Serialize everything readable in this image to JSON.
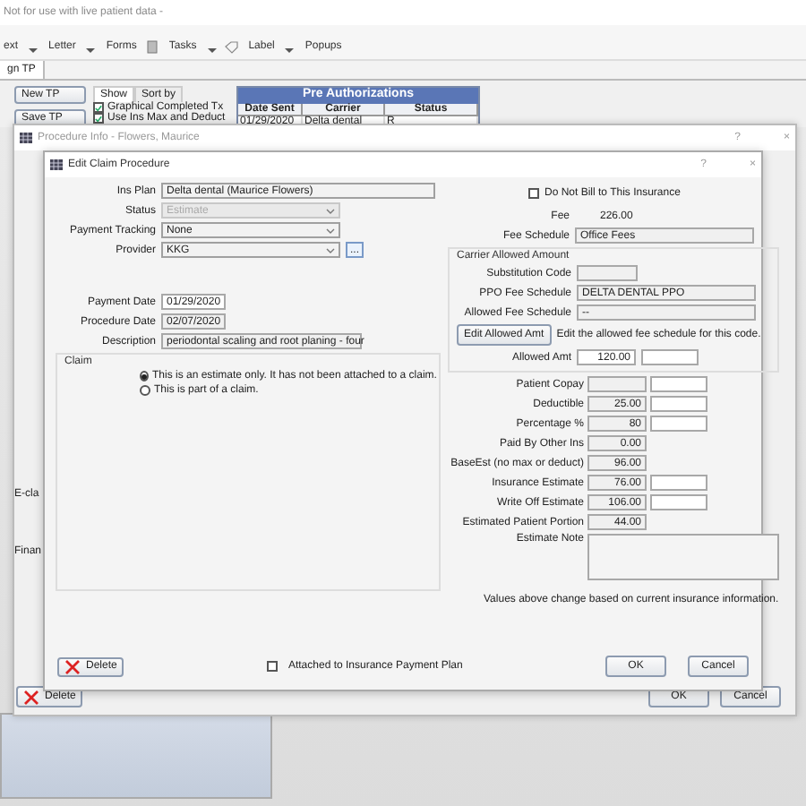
{
  "app": {
    "title": "Not for use with live patient data -",
    "toolbar": [
      {
        "label": "ext",
        "dropdown": true
      },
      {
        "label": "Letter",
        "dropdown": true
      },
      {
        "label": "Forms",
        "dropdown": false
      },
      {
        "label": "Tasks",
        "dropdown": true
      },
      {
        "label": "Label",
        "dropdown": true
      },
      {
        "label": "Popups",
        "dropdown": false
      }
    ],
    "tabs": [
      {
        "label": "gn TP",
        "selected": true
      }
    ],
    "tp_buttons": [
      "New TP",
      "Save TP"
    ],
    "show_tabs": [
      {
        "label": "Show",
        "selected": true
      },
      {
        "label": "Sort by",
        "selected": false
      }
    ],
    "options": [
      {
        "label": "Graphical Completed Tx",
        "checked": true
      },
      {
        "label": "Use Ins Max and Deduct",
        "checked": true
      }
    ],
    "pre_authorizations": {
      "title": "Pre Authorizations",
      "columns": [
        "Date Sent",
        "Carrier",
        "Status"
      ],
      "rows": [
        [
          "01/29/2020",
          "Delta dental",
          "R"
        ]
      ]
    }
  },
  "procedure_info": {
    "title": "Procedure Info - Flowers, Maurice",
    "help": "?",
    "close": "×",
    "fragments": [
      "E-cla",
      "Finan"
    ],
    "buttons": {
      "delete": "Delete",
      "ok": "OK",
      "cancel": "Cancel"
    }
  },
  "edit_claim": {
    "title": "Edit Claim Procedure",
    "help": "?",
    "close": "×",
    "left_fields": [
      {
        "label": "Ins Plan",
        "value": "Delta dental  (Maurice Flowers)",
        "kind": "text",
        "disabled": false
      },
      {
        "label": "Status",
        "value": "Estimate",
        "kind": "combo",
        "disabled": true
      },
      {
        "label": "Payment Tracking",
        "value": "None",
        "kind": "combo",
        "disabled": false
      },
      {
        "label": "Provider",
        "value": "KKG",
        "kind": "combo-pick",
        "pick_button": "...",
        "disabled": false
      }
    ],
    "date_fields": [
      {
        "label": "Payment Date",
        "value": "01/29/2020"
      },
      {
        "label": "Procedure Date",
        "value": "02/07/2020"
      },
      {
        "label": "Description",
        "value": "periodontal scaling and root planing - four"
      }
    ],
    "claim": {
      "title": "Claim",
      "options": [
        {
          "label": "This is an estimate only. It has not been attached to a claim.",
          "selected": true
        },
        {
          "label": "This is part of a claim.",
          "selected": false
        }
      ]
    },
    "do_not_bill": {
      "label": "Do Not Bill to This Insurance",
      "checked": false
    },
    "fee": {
      "label": "Fee",
      "value": "226.00"
    },
    "fee_schedule": {
      "label": "Fee Schedule",
      "value": "Office Fees"
    },
    "carrier_allowed": {
      "title": "Carrier Allowed Amount",
      "fields": [
        {
          "label": "Substitution Code"
        },
        {
          "label": "PPO Fee Schedule",
          "value": "DELTA DENTAL PPO"
        },
        {
          "label": "Allowed Fee Schedule",
          "value": "--"
        }
      ],
      "edit_button": "Edit Allowed Amt",
      "edit_hint": "Edit the allowed fee schedule for this code.",
      "allowed_amt": {
        "label": "Allowed Amt",
        "value": "120.00",
        "has_override": true
      }
    },
    "estimates": [
      {
        "label": "Patient Copay",
        "has_override": true
      },
      {
        "label": "Deductible",
        "value": "25.00",
        "has_override": true
      },
      {
        "label": "Percentage %",
        "value": "80",
        "has_override": true
      },
      {
        "label": "Paid By Other Ins",
        "value": "0.00",
        "has_override": false
      },
      {
        "label": "BaseEst (no max or deduct)",
        "value": "96.00",
        "has_override": false
      },
      {
        "label": "Insurance Estimate",
        "value": "76.00",
        "has_override": true
      },
      {
        "label": "Write Off Estimate",
        "value": "106.00",
        "has_override": true
      },
      {
        "label": "Estimated Patient Portion",
        "value": "44.00",
        "has_override": false
      }
    ],
    "estimate_note": {
      "label": "Estimate Note"
    },
    "note": "Values above change based on current insurance information.",
    "attached": {
      "label": "Attached to Insurance Payment Plan",
      "checked": false
    },
    "buttons": {
      "delete": "Delete",
      "ok": "OK",
      "cancel": "Cancel"
    }
  }
}
